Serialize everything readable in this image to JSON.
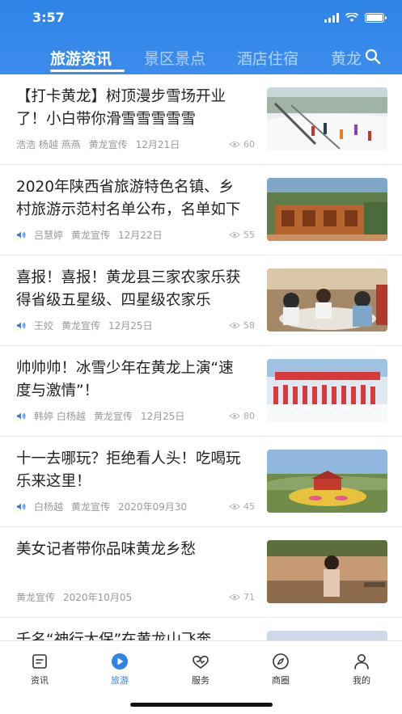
{
  "status": {
    "time": "3:57"
  },
  "tabs": [
    {
      "label": "旅游资讯",
      "active": true
    },
    {
      "label": "景区景点",
      "active": false
    },
    {
      "label": "酒店住宿",
      "active": false
    },
    {
      "label": "黄龙",
      "active": false
    }
  ],
  "articles": [
    {
      "title": "【打卡黄龙】树顶漫步雪场开业了！小白带你滑雪雪雪雪雪",
      "audio": false,
      "authors": "浩浩 杨越 燕燕",
      "source": "黄龙宣传",
      "date": "12月21日",
      "views": "60"
    },
    {
      "title": "2020年陕西省旅游特色名镇、乡村旅游示范村名单公布，名单如下",
      "audio": true,
      "authors": "吕慧婷",
      "source": "黄龙宣传",
      "date": "12月22日",
      "views": "55"
    },
    {
      "title": "喜报！喜报！黄龙县三家农家乐获得省级五星级、四星级农家乐",
      "audio": true,
      "authors": "王姣",
      "source": "黄龙宣传",
      "date": "12月25日",
      "views": "58"
    },
    {
      "title": "帅帅帅！冰雪少年在黄龙上演“速度与激情”！",
      "audio": true,
      "authors": "韩婷 白杨越",
      "source": "黄龙宣传",
      "date": "12月25日",
      "views": "80"
    },
    {
      "title": "十一去哪玩？拒绝看人头！吃喝玩乐来这里！",
      "audio": true,
      "authors": "白杨越",
      "source": "黄龙宣传",
      "date": "2020年09月30",
      "views": "45"
    },
    {
      "title": "美女记者带你品味黄龙乡愁",
      "audio": false,
      "authors": "",
      "source": "黄龙宣传",
      "date": "2020年10月05",
      "views": "71"
    },
    {
      "title": "千名“神行太保”在黄龙山飞奔",
      "audio": false,
      "authors": "",
      "source": "",
      "date": "",
      "views": ""
    }
  ],
  "nav": [
    {
      "label": "资讯",
      "icon": "news-icon",
      "active": false
    },
    {
      "label": "旅游",
      "icon": "play-icon",
      "active": true
    },
    {
      "label": "服务",
      "icon": "service-icon",
      "active": false
    },
    {
      "label": "商圈",
      "icon": "compass-icon",
      "active": false
    },
    {
      "label": "我的",
      "icon": "profile-icon",
      "active": false
    }
  ],
  "colors": {
    "brand": "#2f84e8",
    "meta": "#999999"
  }
}
